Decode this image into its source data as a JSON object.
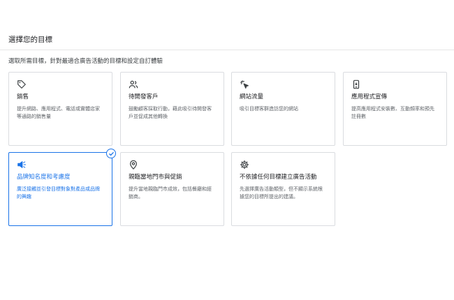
{
  "header": {
    "title": "選擇您的目標"
  },
  "subtitle": "選取所需目標，針對最適合廣告活動的目標和設定自訂體驗",
  "colors": {
    "accent": "#1a73e8",
    "border": "#dadce0",
    "text": "#202124",
    "muted": "#5f6368"
  },
  "goals": [
    {
      "icon": "tag-icon",
      "title": "銷售",
      "desc": "提升網路、應用程式、電話或實體店家等通路的銷售量",
      "selected": false
    },
    {
      "icon": "people-icon",
      "title": "待開發客戶",
      "desc": "鼓勵顧客採取行動，藉此吸引待開發客戶並促成其他轉換",
      "selected": false
    },
    {
      "icon": "cursor-click-icon",
      "title": "網站流量",
      "desc": "吸引目標客群造訪您的網站",
      "selected": false
    },
    {
      "icon": "mobile-app-icon",
      "title": "應用程式宣傳",
      "desc": "提高應用程式安裝數、互動頻率和預先註冊數",
      "selected": false
    },
    {
      "icon": "megaphone-icon",
      "title": "品牌知名度和考慮度",
      "desc": "廣泛接觸並引發目標對象對產品或品牌的興趣",
      "selected": true
    },
    {
      "icon": "location-pin-icon",
      "title": "親臨當地門市與促銷",
      "desc": "提升當地親臨門市成效，包括餐廳和經銷商。",
      "selected": false
    },
    {
      "icon": "gear-icon",
      "title": "不依據任何目標建立廣告活動",
      "desc": "先選擇廣告活動類型，但不顯示系統根據您的目標所提出的建議。",
      "selected": false
    }
  ]
}
